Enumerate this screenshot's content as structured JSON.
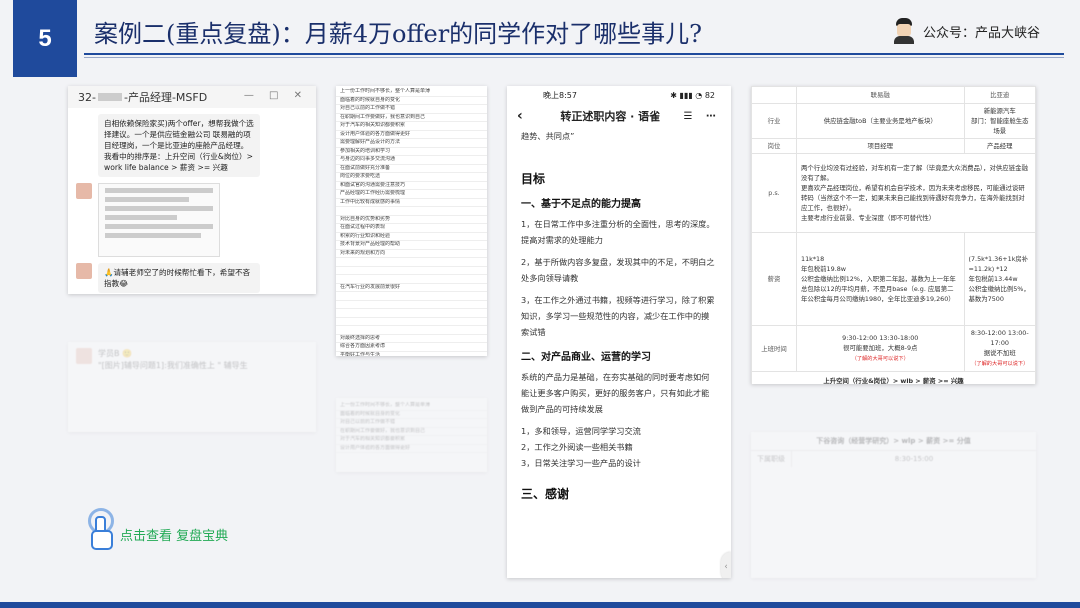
{
  "header": {
    "number": "5",
    "title": "案例二(重点复盘)：月薪4万offer的同学作对了哪些事儿?",
    "brand": "公众号：产品大峡谷"
  },
  "chat": {
    "title": "32-",
    "title_suffix": "-产品经理-MSFD",
    "controls": "— □ ✕",
    "msg1": "自相依赖保险家买)两个offer，想帮我做个选择建议。一个是供应链金融公司 联易融的项目经理岗，一个是比亚迪的座舱产品经理。我看中的排序是：上升空间（行业&岗位）> work life balance > 薪资 >= 兴趣",
    "msg2": "🙏请辅老师空了的时候帮忙看下，希望不吝指教😂"
  },
  "chat_faded": {
    "name": "学员B 🙂",
    "msg": "\"[图片]辅导问题1]:我们准确性上 \" 辅导生"
  },
  "doc_lines": [
    "上一份工作时间不够长，整个人算是单薄",
    "面临着的时候就自身的变化",
    "对自己以前的工作做不错",
    "在职期间工作要做好，我也意识到自己",
    "对于汽车的相关知识都要积累",
    "设计用户体验的各方面做得更好",
    "需要理解好产品设计的方法",
    "参加相关的培训和学习",
    "与身边的同事多交流沟通",
    "在面试前做好充分准备",
    "岗位的要求要吃透",
    "和面试官的沟通需要注意技巧",
    "产品经理的工作经历需要梳理",
    "工作中比较有成就感的事情",
    "",
    "对比自身的优势和劣势",
    "在面试过程中的表现",
    "积累的行业知识和经验",
    "技术背景对产品经理的帮助",
    "对未来的规划和方向",
    "",
    "",
    "",
    "在汽车行业的发展前景很好",
    "",
    "",
    "",
    "",
    "",
    "对最终选择的思考",
    "综合各方面因素考虑",
    "平衡好工作与生活",
    "选择合适自己的岗位",
    "关注行业发展趋势",
    "产品经理的核心能力",
    "沟通协作能力",
    "持续学习能力"
  ],
  "phone": {
    "time": "晚上8:57",
    "status_icons": "✱ ▮▮▮ ◔ 82",
    "nav_title": "转正述职内容 · 语雀",
    "nav_icons": "☰ ⋯",
    "intro": "趋势、共同点”",
    "h_goal": "目标",
    "h_sec1": "一、基于不足点的能力提高",
    "p1": "1，在日常工作中多注重分析的全面性，思考的深度。提高对需求的处理能力",
    "p2": "2，基于所做内容多复盘，发现其中的不足，不明白之处多向领导请教",
    "p3": "3，在工作之外通过书籍，视频等进行学习，除了积累知识，多学习一些规范性的内容，减少在工作中的摸索试错",
    "h_sec2": "二、对产品商业、运营的学习",
    "p4": "系统的产品力是基础，在夯实基础的同时要考虑如何能让更多客户购买，更好的服务客户，只有如此才能做到产品的可持续发展",
    "p5": "1，多和领导，运营同学学习交流",
    "p6": "2，工作之外阅读一些相关书籍",
    "p7": "3，日常关注学习一些产品的设计",
    "h_sec3": "三、感谢",
    "scroll_handle": "‹"
  },
  "table": {
    "col1": "联易融",
    "col2": "比亚迪",
    "rows": [
      {
        "label": "行业",
        "a": "供应链金融toB（主要业务是地产板块）",
        "b": "新能源汽车\n部门：智能座舱生态场景"
      },
      {
        "label": "岗位",
        "a": "项目经理",
        "b": "产品经理"
      },
      {
        "label": "p.s.",
        "a": "两个行业均没有过经验，对车机有一定了解（毕竟是大众消费品），对供应链金融没有了解。\n更喜欢产品经理岗位，希望有机会自学技术，因为未来考虑移民，可能通过谈研转码（当然这个不一定，如果未来自己能找到待遇好有竞争力，在海外能找到对应工作，也很好）。\n主要考虑行业前景、专业深度（即不可替代性）",
        "b": ""
      },
      {
        "label": "薪资",
        "a": "11k*18\n年包税前19.8w\n公积金缴纳比例12%，入职第二年起，基数为上一年年总包除以12的平均月薪，不是月base（e.g. 应届第二年公积金每月公司缴纳1980，全年比亚迪多19,260）",
        "b": "(7.5k*1.36+1k房补=11.2k) *12\n年包税前13.44w\n公积金缴纳比例5%，基数为7500"
      },
      {
        "label": "上班时间",
        "a": "9:30-12:00 13:30-18:00\n很可能要加班，大概8-9点",
        "a_red": "（了解的大哥可以说下）",
        "b": "8:30-12:00 13:00-17:00\n据说不加班",
        "b_red": "（了解的大哥可以说下）"
      }
    ],
    "footer": "上升空间（行业&岗位）> wlb > 薪资 >= 兴趣"
  },
  "table_faded": {
    "footer": "下谷咨询（经营学研究）> wlp > 薪资 >= 分值",
    "row1": "下属职级",
    "cell": "8:30-15:00"
  },
  "tap_button": {
    "label": "点击查看 复盘宝典"
  },
  "colors": {
    "brand_blue": "#1f4a9c",
    "link_green": "#22aa55",
    "alert_red": "#dd2222"
  }
}
